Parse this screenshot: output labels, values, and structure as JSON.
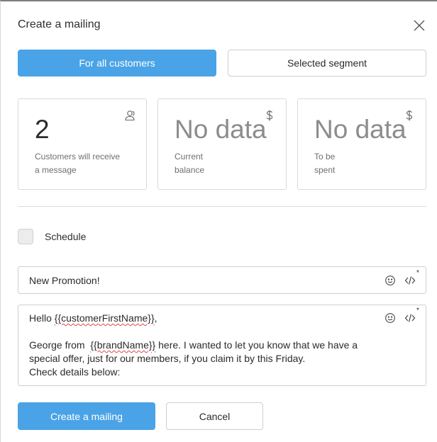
{
  "dialog": {
    "title": "Create a mailing",
    "close_icon": "close-icon"
  },
  "audience": {
    "all_label": "For all customers",
    "segment_label": "Selected segment",
    "selected": "all"
  },
  "stats": [
    {
      "value": "2",
      "desc_line1": "Customers will receive",
      "desc_line2": "a message",
      "icon": "users-icon"
    },
    {
      "value": "No data",
      "desc_line1": "Current",
      "desc_line2": "balance",
      "icon": "dollar-icon"
    },
    {
      "value": "No data",
      "desc_line1": "To be",
      "desc_line2": "spent",
      "icon": "dollar-icon"
    }
  ],
  "schedule": {
    "label": "Schedule",
    "checked": false
  },
  "subject": {
    "value": "New Promotion!",
    "required_mark": "*"
  },
  "message": {
    "line1_prefix": "Hello ",
    "line1_var": "{{customerFirstName}}",
    "line1_suffix": ",",
    "line2_prefix": "George from  ",
    "line2_var": "{{brandName}}",
    "line2_suffix": " here. I wanted to let you know that we have a",
    "line3": "special offer, just for our members, if you claim it by this Friday.",
    "line4": "Check details below:",
    "required_mark": "*"
  },
  "icons": {
    "emoji": "smiley-icon",
    "code": "code-icon"
  },
  "actions": {
    "create_label": "Create a mailing",
    "cancel_label": "Cancel"
  },
  "colors": {
    "primary": "#4aa3e6",
    "border": "#cfcfcf",
    "muted_text": "#6f6f6f"
  }
}
